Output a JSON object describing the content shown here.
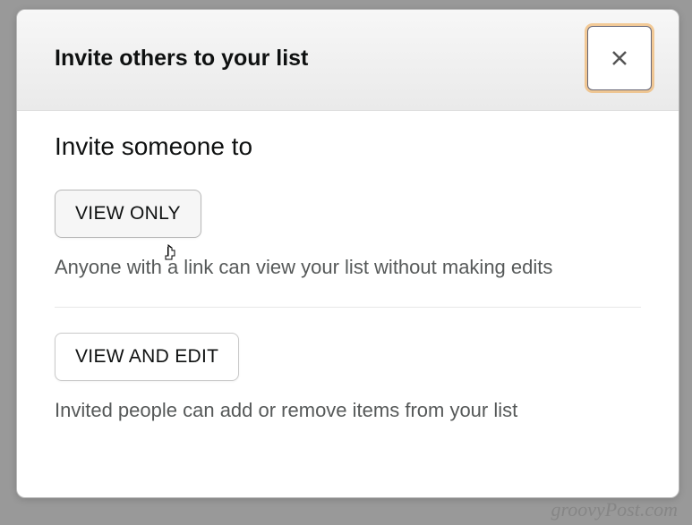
{
  "modal": {
    "title": "Invite others to your list",
    "section_title": "Invite someone to",
    "options": [
      {
        "button_label": "VIEW ONLY",
        "description": "Anyone with a link can view your list without making edits"
      },
      {
        "button_label": "VIEW AND EDIT",
        "description": "Invited people can add or remove items from your list"
      }
    ]
  },
  "watermark": "groovyPost.com"
}
